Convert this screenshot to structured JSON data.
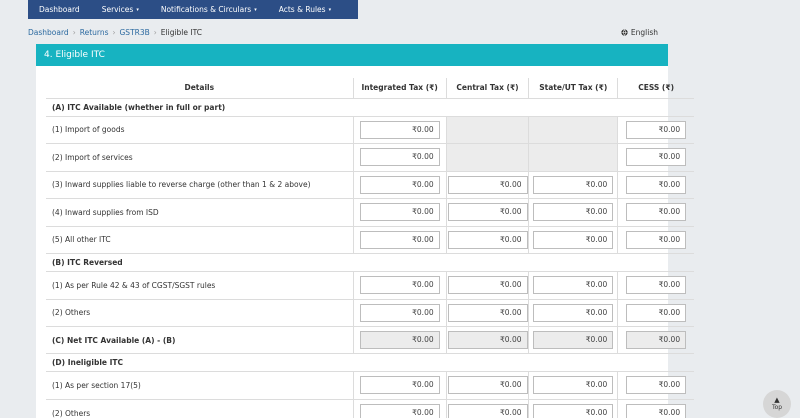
{
  "nav": {
    "items": [
      {
        "label": "Dashboard",
        "dropdown": false
      },
      {
        "label": "Services",
        "dropdown": true
      },
      {
        "label": "Notifications & Circulars",
        "dropdown": true
      },
      {
        "label": "Acts & Rules",
        "dropdown": true
      }
    ],
    "caret": "▾"
  },
  "breadcrumb": {
    "items": [
      "Dashboard",
      "Returns",
      "GSTR3B"
    ],
    "current": "Eligible ITC",
    "separator": "›"
  },
  "language": {
    "icon": "globe-icon",
    "label": "English"
  },
  "section_title": "4. Eligible ITC",
  "table": {
    "headers": [
      "Details",
      "Integrated Tax (₹)",
      "Central Tax (₹)",
      "State/UT Tax (₹)",
      "CESS (₹)"
    ],
    "sections": {
      "a": "(A) ITC Available (whether in full or part)",
      "b": "(B) ITC Reversed",
      "c": "(C) Net ITC Available (A) - (B)",
      "d": "(D) Ineligible ITC"
    },
    "rows": {
      "import_goods": {
        "label": "(1) Import of goods",
        "igst": "₹0.00",
        "cess": "₹0.00"
      },
      "import_services": {
        "label": "(2) Import of services",
        "igst": "₹0.00",
        "cess": "₹0.00"
      },
      "reverse_charge": {
        "label": "(3) Inward supplies liable to reverse charge (other than 1 & 2 above)",
        "igst": "₹0.00",
        "cgst": "₹0.00",
        "sgst": "₹0.00",
        "cess": "₹0.00"
      },
      "isd": {
        "label": "(4) Inward supplies from ISD",
        "igst": "₹0.00",
        "cgst": "₹0.00",
        "sgst": "₹0.00",
        "cess": "₹0.00"
      },
      "all_other": {
        "label": "(5) All other ITC",
        "igst": "₹0.00",
        "cgst": "₹0.00",
        "sgst": "₹0.00",
        "cess": "₹0.00"
      },
      "rule_42_43": {
        "label": "(1) As per Rule 42 & 43 of CGST/SGST rules",
        "igst": "₹0.00",
        "cgst": "₹0.00",
        "sgst": "₹0.00",
        "cess": "₹0.00"
      },
      "others_b": {
        "label": "(2) Others",
        "igst": "₹0.00",
        "cgst": "₹0.00",
        "sgst": "₹0.00",
        "cess": "₹0.00"
      },
      "net": {
        "igst": "₹0.00",
        "cgst": "₹0.00",
        "sgst": "₹0.00",
        "cess": "₹0.00"
      },
      "sec_17_5": {
        "label": "(1) As per section 17(5)",
        "igst": "₹0.00",
        "cgst": "₹0.00",
        "sgst": "₹0.00",
        "cess": "₹0.00"
      },
      "others_d": {
        "label": "(2) Others",
        "igst": "₹0.00",
        "cgst": "₹0.00",
        "sgst": "₹0.00",
        "cess": "₹0.00"
      }
    }
  },
  "top_button": {
    "label": "Top",
    "icon": "chevron-up-icon"
  },
  "colors": {
    "nav_bg": "#2c4e86",
    "section_header": "#17b3c1",
    "page_bg": "#e9ecef",
    "link": "#2c6aa0"
  }
}
